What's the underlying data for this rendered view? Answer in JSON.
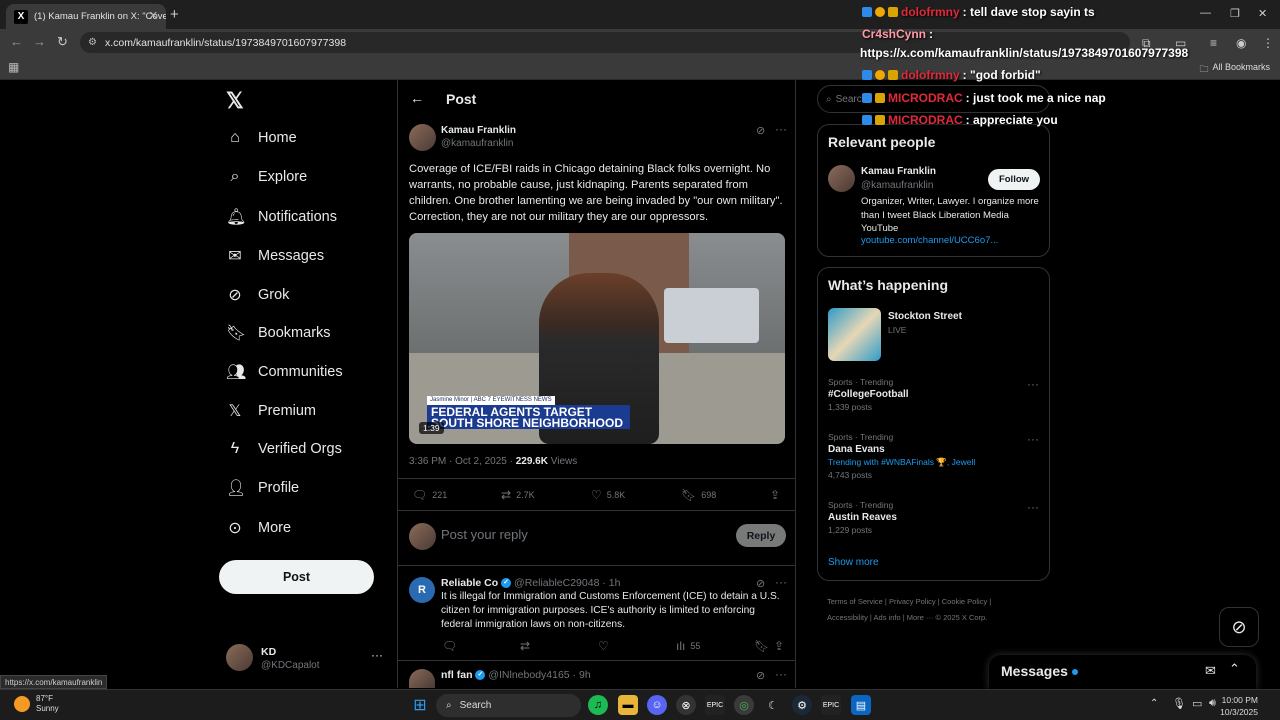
{
  "browser": {
    "tab_title": "(1) Kamau Franklin on X: \"Cove",
    "url": "x.com/kamaufranklin/status/1973849701607977398",
    "all_bookmarks": "All Bookmarks",
    "status_url": "https://x.com/kamaufranklin"
  },
  "chat": [
    {
      "user": "dolofrmny",
      "message": ": tell dave stop sayin ts"
    },
    {
      "user": "Cr4shCynn",
      "message": " :"
    },
    {
      "user": "",
      "message": "https://x.com/kamaufranklin/status/1973849701607977398"
    },
    {
      "user": "dolofrmny",
      "message": ": \"god forbid\""
    },
    {
      "user": "MICRODRAC",
      "message": ": just took me a nice nap"
    },
    {
      "user": "MICRODRAC",
      "message": ": appreciate you"
    }
  ],
  "sidebar": {
    "items": [
      {
        "label": "Home",
        "icon": "home-icon"
      },
      {
        "label": "Explore",
        "icon": "search-icon"
      },
      {
        "label": "Notifications",
        "icon": "bell-icon"
      },
      {
        "label": "Messages",
        "icon": "envelope-icon"
      },
      {
        "label": "Grok",
        "icon": "grok-icon"
      },
      {
        "label": "Bookmarks",
        "icon": "bookmark-icon"
      },
      {
        "label": "Communities",
        "icon": "people-icon"
      },
      {
        "label": "Premium",
        "icon": "x-icon"
      },
      {
        "label": "Verified Orgs",
        "icon": "lightning-icon"
      },
      {
        "label": "Profile",
        "icon": "person-icon"
      },
      {
        "label": "More",
        "icon": "more-circle-icon"
      }
    ],
    "post_label": "Post",
    "account": {
      "name": "KD",
      "handle": "@KDCapalot"
    }
  },
  "post": {
    "header_title": "Post",
    "author_name": "Kamau Franklin",
    "author_handle": "@kamaufranklin",
    "text": "Coverage of ICE/FBI raids in Chicago detaining Black folks overnight. No warrants, no probable cause, just kidnaping. Parents separated from children. One brother lamenting we are being invaded by \"our own military\". Correction, they are not our military they are our oppressors.",
    "video": {
      "reporter_tag": "Jasmine Minor | ABC 7 EYEWITNESS NEWS",
      "headline_line1": "FEDERAL AGENTS TARGET",
      "headline_line2": "SOUTH SHORE NEIGHBORHOOD",
      "duration": "1:39"
    },
    "time": "3:36 PM · Oct 2, 2025 · ",
    "views": "229.6K",
    "views_label": " Views",
    "stats": {
      "replies": "221",
      "reposts": "2.7K",
      "likes": "5.8K",
      "bookmarks": "698"
    },
    "reply_placeholder": "Post your reply",
    "reply_button": "Reply"
  },
  "replies": [
    {
      "name": "Reliable Co",
      "handle": "@ReliableC29048 · 1h",
      "text": "It is illegal for Immigration and Customs Enforcement (ICE) to detain a U.S. citizen for immigration purposes. ICE's authority is limited to enforcing federal immigration laws on non-citizens.",
      "views": "55"
    },
    {
      "name": "nfl fan",
      "handle": "@INlnebody4165 · 9h"
    }
  ],
  "right": {
    "search_placeholder": "Search",
    "relevant_title": "Relevant people",
    "person": {
      "name": "Kamau Franklin",
      "handle": "@kamaufranklin",
      "follow": "Follow",
      "bio": "Organizer, Writer, Lawyer. I organize more than I tweet Black Liberation Media YouTube",
      "link": "youtube.com/channel/UCC6o7..."
    },
    "happening_title": "What’s happening",
    "live_event": {
      "name": "Stockton Street",
      "status": "LIVE"
    },
    "trends": [
      {
        "context": "Sports · Trending",
        "name": "#CollegeFootball",
        "extra": "",
        "posts": "1,339 posts"
      },
      {
        "context": "Sports · Trending",
        "name": "Dana Evans",
        "extra": "Trending with #WNBAFinals 🏆, Jewell",
        "posts": "4,743 posts"
      },
      {
        "context": "Sports · Trending",
        "name": "Austin Reaves",
        "extra": "",
        "posts": "1,229 posts"
      }
    ],
    "show_more": "Show more",
    "footer_line1": "Terms of Service  |  Privacy Policy  |  Cookie Policy  |",
    "footer_line2": "Accessibility  |  Ads info  |  More ···  © 2025 X Corp.",
    "messages_label": "Messages"
  },
  "taskbar": {
    "temp": "87°F",
    "condition": "Sunny",
    "search": "Search",
    "time": "10:00 PM",
    "date": "10/3/2025"
  },
  "colors": {
    "accent": "#1d9bf0",
    "chat_user": "#e0293a",
    "bg": "#000000"
  }
}
